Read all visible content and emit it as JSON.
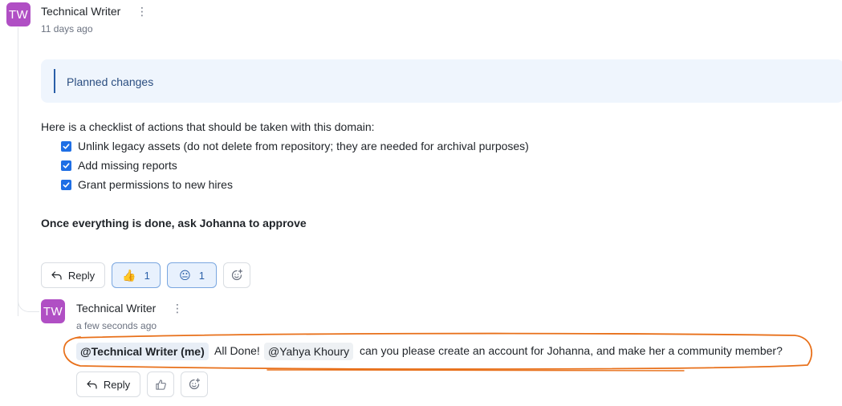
{
  "post": {
    "avatar_initials": "TW",
    "author": "Technical Writer",
    "timestamp": "11 days ago",
    "callout": "Planned changes",
    "intro": "Here is a checklist of actions that should be taken with this domain:",
    "checklist": [
      {
        "label": "Unlink legacy assets (do not delete from repository; they are needed for archival purposes)",
        "checked": true
      },
      {
        "label": "Add missing reports",
        "checked": true
      },
      {
        "label": "Grant permissions to new hires",
        "checked": true
      }
    ],
    "closing": "Once everything is done, ask Johanna to approve",
    "actions": {
      "reply_label": "Reply",
      "reactions": [
        {
          "emoji": "👍",
          "count": "1"
        },
        {
          "emoji": "😐",
          "count": "1"
        }
      ]
    }
  },
  "reply": {
    "avatar_initials": "TW",
    "author": "Technical Writer",
    "timestamp": "a few seconds ago",
    "mention_self": "@Technical Writer (me)",
    "text_1": "All Done!",
    "mention_other": "@Yahya Khoury",
    "text_2": "can you please create an account for Johanna, and make her a community member?",
    "actions": {
      "reply_label": "Reply"
    }
  },
  "colors": {
    "avatar": "#b04fc4",
    "accent": "#1f6fe5",
    "highlight": "#e8701a"
  },
  "icons": {
    "kebab": "vertical-ellipsis-icon",
    "reply": "reply-arrow-icon",
    "thumbs_up": "thumbs-up-icon",
    "add_reaction": "add-reaction-icon",
    "checkbox": "checkmark-icon"
  }
}
